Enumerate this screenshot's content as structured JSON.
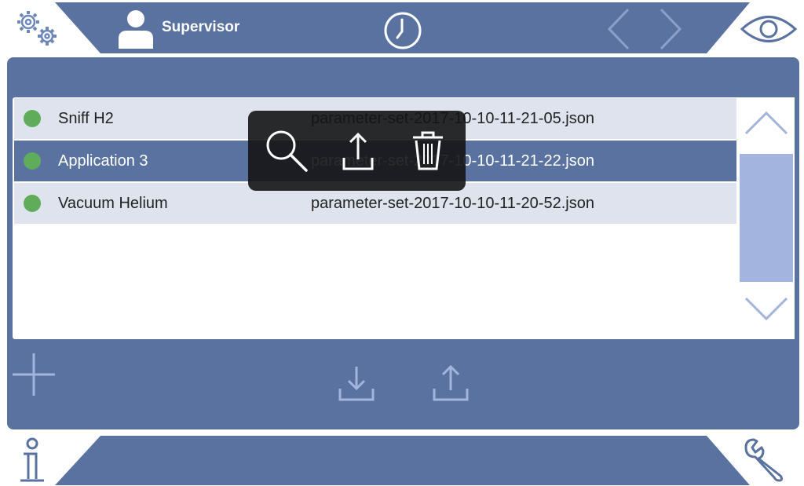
{
  "header": {
    "user_role": "Supervisor"
  },
  "parameter_sets": [
    {
      "name": "Sniff H2",
      "file": "parameter-set-2017-10-10-11-21-05.json",
      "status": "green",
      "selected": false
    },
    {
      "name": "Application 3",
      "file": "parameter-set-2017-10-10-11-21-22.json",
      "status": "green",
      "selected": true
    },
    {
      "name": "Vacuum Helium",
      "file": "parameter-set-2017-10-10-11-20-52.json",
      "status": "green",
      "selected": false
    }
  ],
  "overlay_actions": [
    "search-icon",
    "upload-icon",
    "trash-icon"
  ],
  "footer_actions": [
    "add-icon",
    "import-icon",
    "export-icon"
  ],
  "colors": {
    "primary": "#5a72a0",
    "row_light": "#dfe3ed",
    "scroll_thumb": "#a3b5de",
    "status_ok": "#5fad5a",
    "icon_blue": "#6d87b8"
  }
}
